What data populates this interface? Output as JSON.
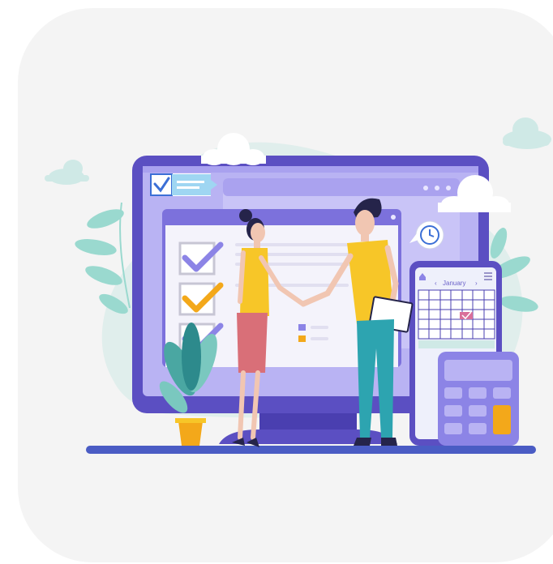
{
  "illustration": {
    "calendar_month": "January",
    "colors": {
      "card_background": "#f4f4f4",
      "monitor_frame": "#5b4fc2",
      "screen_background": "#b9b3f3",
      "checkmark_purple": "#8c84e6",
      "checkmark_orange": "#f3a81a",
      "shirt_yellow": "#f7c628",
      "skirt_pink": "#d96f78",
      "pants_teal": "#2da4b0",
      "leaf_mint": "#9ad9cf",
      "floor_line": "#4a5cc4"
    },
    "icons": [
      "checkbox-chat-icon",
      "clock-bubble-icon",
      "home-icon",
      "menu-icon",
      "calculator-icon",
      "potted-plant-icon",
      "cloud-icon"
    ]
  }
}
